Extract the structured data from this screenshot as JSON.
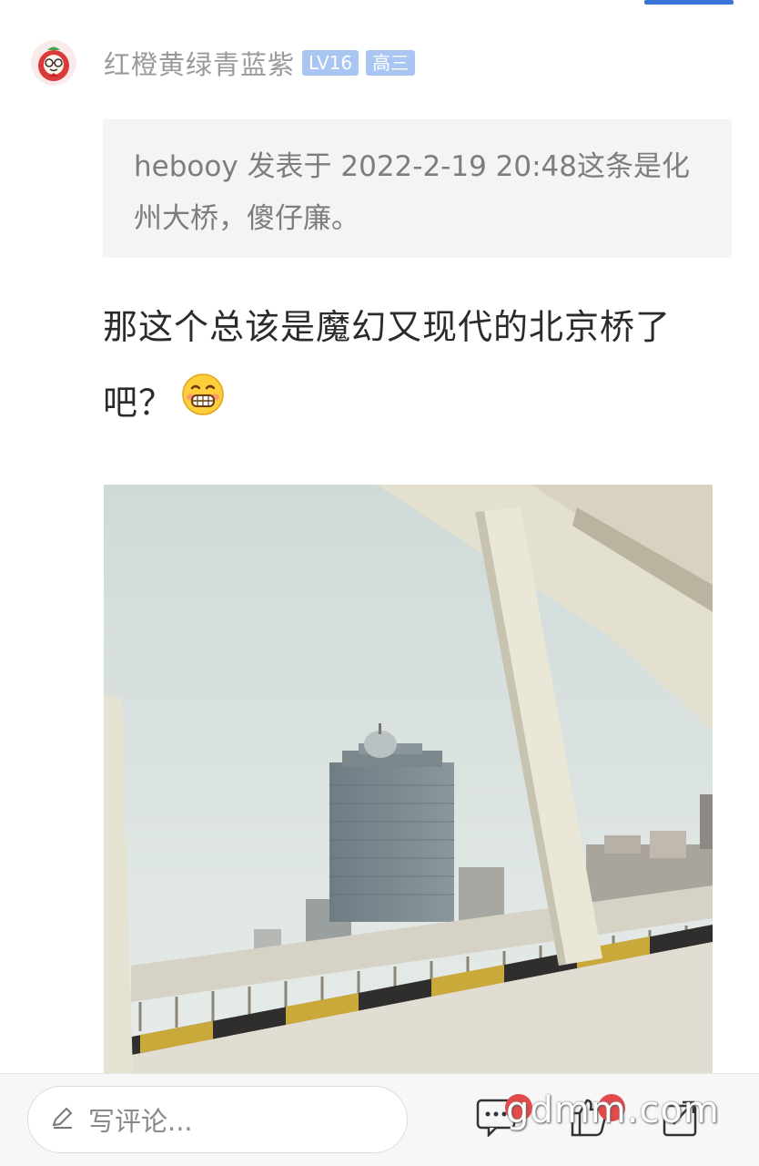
{
  "user": {
    "name": "红橙黄绿青蓝紫",
    "level_badge": "LV16",
    "grade_badge": "高三"
  },
  "quote": {
    "text": "hebooy 发表于 2022-2-19 20:48这条是化州大桥，傻仔廉。"
  },
  "post": {
    "line1": "那这个总该是魔幻又现代的北京桥了",
    "line2": "吧？"
  },
  "bottom_bar": {
    "comment_placeholder": "写评论..."
  },
  "watermark": "gdmm.com",
  "colors": {
    "accent": "#3a74d6",
    "badge": "#a9c6f3",
    "notify": "#e34b4b"
  }
}
